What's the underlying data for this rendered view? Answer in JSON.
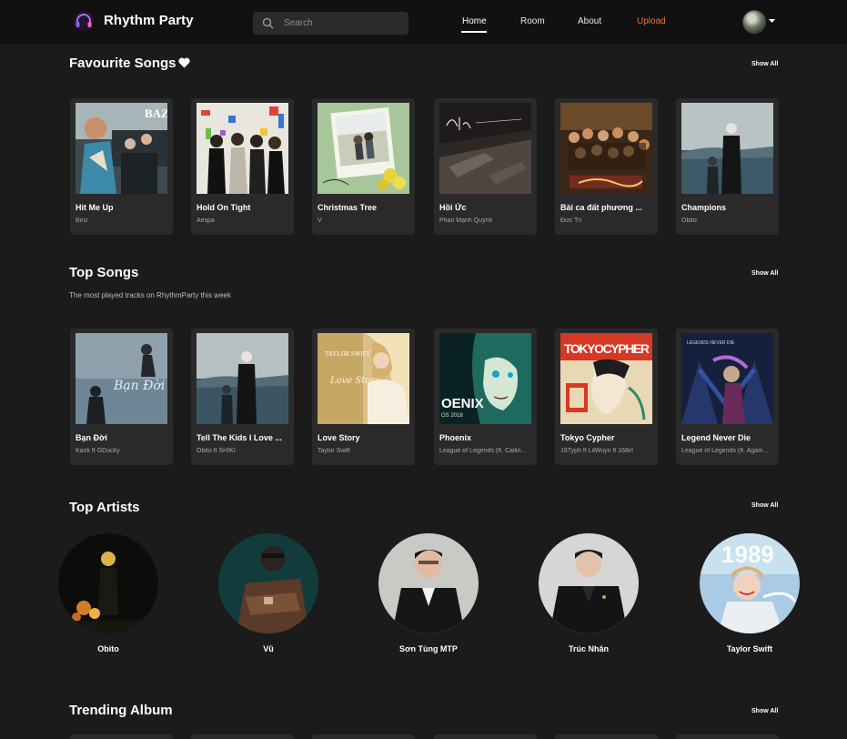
{
  "nav": {
    "brand": "Rhythm Party",
    "search_placeholder": "Search",
    "links": [
      "Home",
      "Room",
      "About",
      "Upload"
    ],
    "active": "Home",
    "upload_color": "#e6763a"
  },
  "sections": {
    "favourite": {
      "title": "Favourite Songs",
      "show_all": "Show All",
      "icon": "heart-icon",
      "songs": [
        {
          "title": "Hit Me Up",
          "artist": "Binz"
        },
        {
          "title": "Hold On Tight",
          "artist": "Aespa"
        },
        {
          "title": "Christmas Tree",
          "artist": "V"
        },
        {
          "title": "Hồi Ức",
          "artist": "Phan Mạnh Quỳnh"
        },
        {
          "title": "Bài ca đất phương ...",
          "artist": "Đức Trí"
        },
        {
          "title": "Champions",
          "artist": "Obito"
        }
      ]
    },
    "top_songs": {
      "title": "Top Songs",
      "subtitle": "The most played tracks on RhythmParty this week",
      "show_all": "Show All",
      "songs": [
        {
          "title": "Bạn Đời",
          "artist": "Karik ft GDucky"
        },
        {
          "title": "Tell The Kids I Love ...",
          "artist": "Obito ft SHIKI"
        },
        {
          "title": "Love Story",
          "artist": "Taylor Swift"
        },
        {
          "title": "Phoenix",
          "artist": "League of Legends (ft. Cailin..."
        },
        {
          "title": "Tokyo Cypher",
          "artist": "16Typh ft LilWuyn ft 16Brt"
        },
        {
          "title": "Legend Never Die",
          "artist": "League of Legends (ft. Again..."
        }
      ]
    },
    "top_artists": {
      "title": "Top Artists",
      "show_all": "Show All",
      "artists": [
        "Obito",
        "Vũ",
        "Sơn Tùng MTP",
        "Trúc Nhân",
        "Taylor Swift"
      ]
    },
    "trending_album": {
      "title": "Trending Album",
      "show_all": "Show All"
    }
  },
  "artwork_text": {
    "hit_me_up": "BAZ",
    "ban_doi": "Bạn Đời",
    "love_story_top": "TAYLOR SWIFT",
    "love_story_script": "Love Story",
    "phoenix": "OENIX",
    "phoenix_year": "OS 2018",
    "tokyo_cypher": "TOKYOCYPHER",
    "legends": "LEGENDS NEVER DIE",
    "taylor_1989": "1989"
  },
  "colors": {
    "background": "#1b1b1b",
    "navbar": "#111111",
    "card": "#2a2a2a",
    "accent": "#e6763a"
  }
}
